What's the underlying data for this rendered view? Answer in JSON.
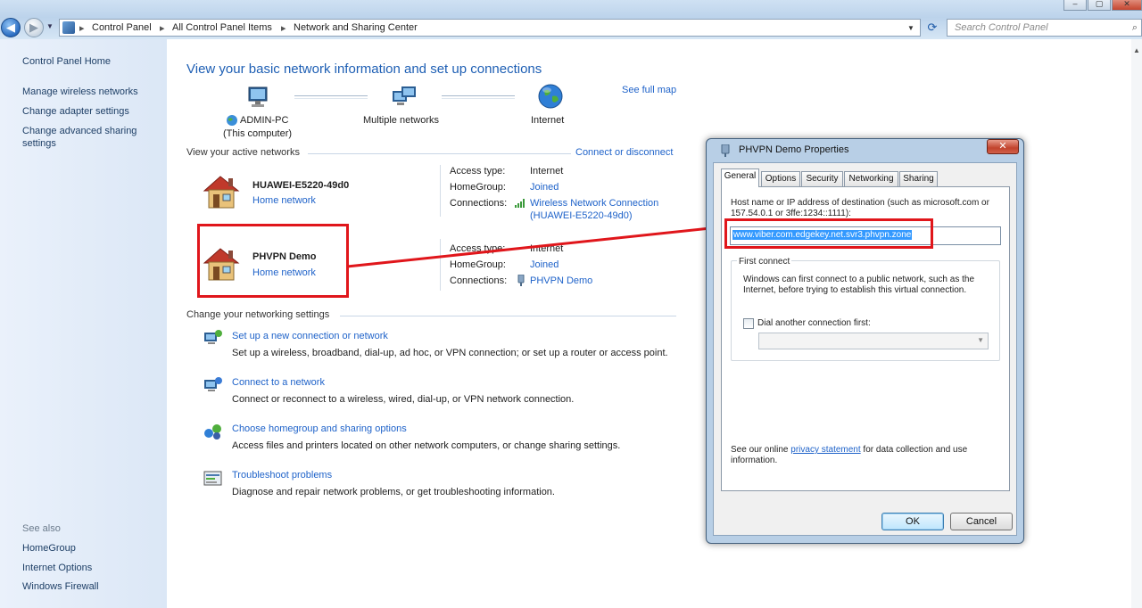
{
  "window": {
    "breadcrumbs": [
      "Control Panel",
      "All Control Panel Items",
      "Network and Sharing Center"
    ],
    "search_placeholder": "Search Control Panel",
    "controls": {
      "minimize": "–",
      "maximize": "▢",
      "close": "✕"
    }
  },
  "sidebar": {
    "home": "Control Panel Home",
    "items": [
      {
        "label": "Manage wireless networks"
      },
      {
        "label": "Change adapter settings"
      },
      {
        "label": "Change advanced sharing"
      },
      {
        "label": "settings"
      }
    ],
    "see_also_label": "See also",
    "see_also": [
      {
        "label": "HomeGroup"
      },
      {
        "label": "Internet Options"
      },
      {
        "label": "Windows Firewall"
      }
    ]
  },
  "main": {
    "title": "View your basic network information and set up connections",
    "see_full_map": "See full map",
    "map": {
      "computer_name": "ADMIN-PC",
      "computer_sub": "(This computer)",
      "middle": "Multiple networks",
      "internet": "Internet"
    },
    "active_networks_label": "View your active networks",
    "connect_disconnect": "Connect or disconnect",
    "networks": [
      {
        "name": "HUAWEI-E5220-49d0",
        "type": "Home network",
        "access_type_label": "Access type:",
        "access_type": "Internet",
        "homegroup_label": "HomeGroup:",
        "homegroup": "Joined",
        "connections_label": "Connections:",
        "connection": "Wireless Network Connection",
        "connection_sub": "(HUAWEI-E5220-49d0)"
      },
      {
        "name": "PHVPN Demo",
        "type": "Home network",
        "access_type_label": "Access type:",
        "access_type": "Internet",
        "homegroup_label": "HomeGroup:",
        "homegroup": "Joined",
        "connections_label": "Connections:",
        "connection": "PHVPN Demo"
      }
    ],
    "change_settings_label": "Change your networking settings",
    "tasks": [
      {
        "title": "Set up a new connection or network",
        "desc": "Set up a wireless, broadband, dial-up, ad hoc, or VPN connection; or set up a router or access point."
      },
      {
        "title": "Connect to a network",
        "desc": "Connect or reconnect to a wireless, wired, dial-up, or VPN network connection."
      },
      {
        "title": "Choose homegroup and sharing options",
        "desc": "Access files and printers located on other network computers, or change sharing settings."
      },
      {
        "title": "Troubleshoot problems",
        "desc": "Diagnose and repair network problems, or get troubleshooting information."
      }
    ]
  },
  "dialog": {
    "title": "PHVPN Demo Properties",
    "close": "✕",
    "tabs": [
      "General",
      "Options",
      "Security",
      "Networking",
      "Sharing"
    ],
    "host_label_1": "Host name or IP address of destination (such as microsoft.com or",
    "host_label_2": "157.54.0.1 or 3ffe:1234::1111):",
    "host_value": "www.viber.com.edgekey.net.svr3.phvpn.zone",
    "first_connect_label": "First connect",
    "first_connect_text_1": "Windows can first connect to a public network, such as the",
    "first_connect_text_2": "Internet, before trying to establish this virtual connection.",
    "dial_another_label": "Dial another connection first:",
    "privacy_prefix": "See our online ",
    "privacy_link": "privacy statement",
    "privacy_suffix": " for data collection and use",
    "privacy_line2": "information.",
    "ok": "OK",
    "cancel": "Cancel"
  }
}
